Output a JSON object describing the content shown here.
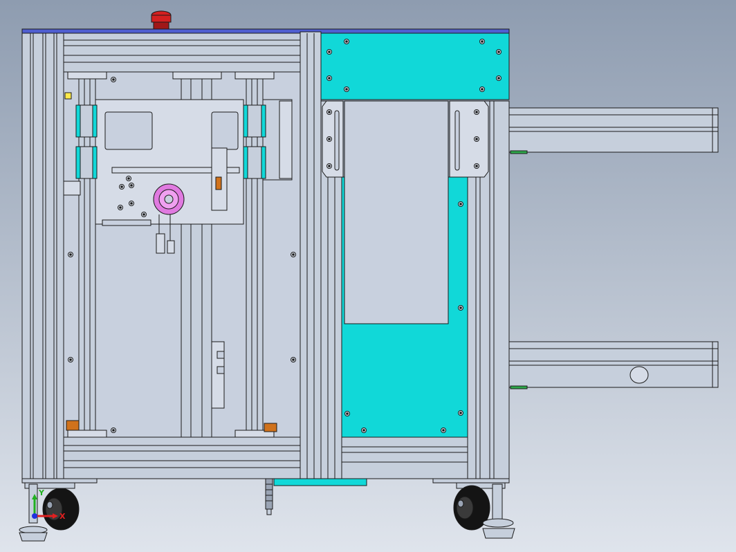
{
  "viewport": {
    "background_top": "#8e9cb0",
    "background_bottom": "#dfe4ec"
  },
  "colors": {
    "frame": "#c6cfdc",
    "frame_dark": "#9aa4b4",
    "panel": "#c8d0de",
    "panel_light": "#d6dce7",
    "cyan": "#11d8d8",
    "top_rail": "#4f5ed0",
    "estop_red": "#d42020",
    "wheel": "#141414",
    "orange": "#d0721c",
    "pink": "#e07ae0",
    "outline": "#1a1a1a",
    "green": "#2ea84a",
    "yellow": "#ffe94a"
  },
  "triad": {
    "x_label": "X",
    "y_label": "Y",
    "x_color": "#e02020",
    "y_color": "#20b020",
    "z_color": "#2030e0"
  }
}
